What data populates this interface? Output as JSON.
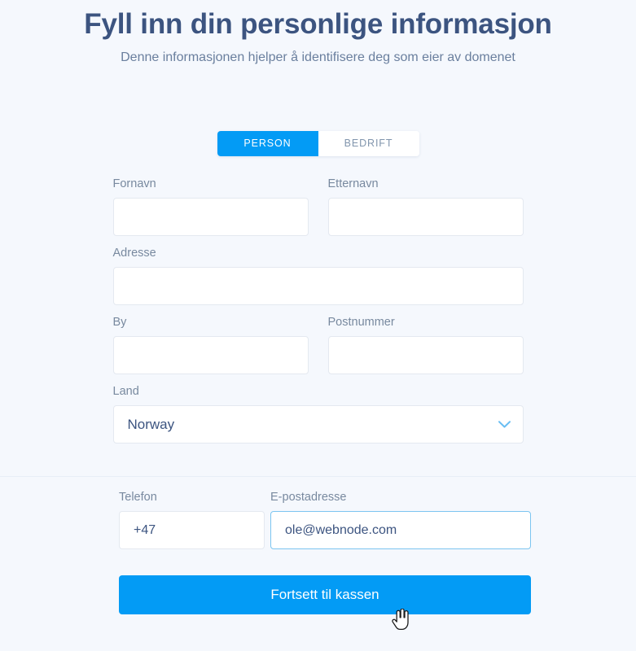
{
  "header": {
    "title": "Fyll inn din personlige informasjon",
    "subtitle": "Denne informasjonen hjelper å identifisere deg som eier av domenet"
  },
  "toggle": {
    "person_label": "PERSON",
    "company_label": "BEDRIFT",
    "active": "PERSON"
  },
  "form": {
    "first_name": {
      "label": "Fornavn",
      "value": "",
      "placeholder": ""
    },
    "last_name": {
      "label": "Etternavn",
      "value": "",
      "placeholder": ""
    },
    "address": {
      "label": "Adresse",
      "value": "",
      "placeholder": ""
    },
    "city": {
      "label": "By",
      "value": "",
      "placeholder": ""
    },
    "postal_code": {
      "label": "Postnummer",
      "value": "",
      "placeholder": ""
    },
    "country": {
      "label": "Land",
      "value": "Norway"
    },
    "phone": {
      "label": "Telefon",
      "value": "+47",
      "placeholder": ""
    },
    "email": {
      "label": "E-postadresse",
      "value": "ole@webnode.com",
      "placeholder": ""
    }
  },
  "submit": {
    "label": "Fortsett til kassen"
  },
  "icons": {
    "chevron_down": "chevron-down-icon",
    "cursor": "pointer-hand-cursor"
  },
  "colors": {
    "accent": "#039bf5",
    "title": "#3c5480",
    "label": "#78899f",
    "background": "#f5f8fd",
    "input_border": "#e4e9f0",
    "focus_border": "#7cc5f0"
  }
}
